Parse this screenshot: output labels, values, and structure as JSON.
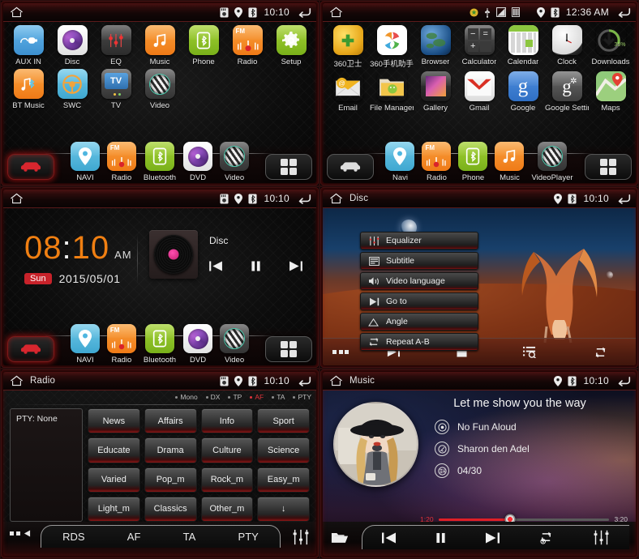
{
  "panels": {
    "home_apps": {
      "statusbar": {
        "time": "10:10",
        "icons": [
          "sdcard-icon",
          "location-pin-icon",
          "bluetooth-icon"
        ],
        "back": "back-arrow-icon"
      },
      "apps_row1": [
        {
          "label": "AUX IN",
          "icon": "aux-plug-icon"
        },
        {
          "label": "Disc",
          "icon": "disc-icon"
        },
        {
          "label": "EQ",
          "icon": "equalizer-icon"
        },
        {
          "label": "Music",
          "icon": "music-note-icon"
        },
        {
          "label": "Phone",
          "icon": "bluetooth-phone-icon"
        },
        {
          "label": "Radio",
          "icon": "fm-radio-icon"
        },
        {
          "label": "Setup",
          "icon": "gear-icon"
        }
      ],
      "apps_row2": [
        {
          "label": "BT Music",
          "icon": "bt-music-icon"
        },
        {
          "label": "SWC",
          "icon": "steering-wheel-icon"
        },
        {
          "label": "TV",
          "icon": "tv-icon"
        },
        {
          "label": "Video",
          "icon": "video-icon"
        }
      ],
      "dock": [
        {
          "label": "NAVI",
          "icon": "location-pin-icon"
        },
        {
          "label": "Radio",
          "icon": "fm-radio-icon"
        },
        {
          "label": "Bluetooth",
          "icon": "bluetooth-icon"
        },
        {
          "label": "DVD",
          "icon": "disc-icon"
        },
        {
          "label": "Video",
          "icon": "video-icon"
        }
      ]
    },
    "android_apps": {
      "statusbar": {
        "time": "12:36 AM",
        "icons": [
          "shield-icon",
          "usb-icon",
          "screenshot-icon",
          "sim-icon",
          "location-pin-icon",
          "bluetooth-icon"
        ],
        "back": "back-arrow-icon"
      },
      "apps_row1": [
        {
          "label": "360卫士",
          "icon": "360-guard-icon"
        },
        {
          "label": "360手机助手",
          "icon": "360-assistant-icon"
        },
        {
          "label": "Browser",
          "icon": "globe-icon"
        },
        {
          "label": "Calculator",
          "icon": "calculator-icon"
        },
        {
          "label": "Calendar",
          "icon": "calendar-icon"
        },
        {
          "label": "Clock",
          "icon": "clock-icon"
        },
        {
          "label": "Downloads",
          "icon": "download-icon",
          "badge": "36%"
        }
      ],
      "apps_row2": [
        {
          "label": "Email",
          "icon": "email-icon"
        },
        {
          "label": "File Manager",
          "icon": "folder-icon"
        },
        {
          "label": "Gallery",
          "icon": "gallery-icon"
        },
        {
          "label": "Gmail",
          "icon": "gmail-icon"
        },
        {
          "label": "Google",
          "icon": "google-g-icon"
        },
        {
          "label": "Google Settings",
          "icon": "google-settings-icon"
        },
        {
          "label": "Maps",
          "icon": "maps-icon"
        }
      ],
      "dock": [
        {
          "label": "Navi",
          "icon": "location-pin-icon"
        },
        {
          "label": "Radio",
          "icon": "fm-radio-icon"
        },
        {
          "label": "Phone",
          "icon": "bluetooth-phone-icon"
        },
        {
          "label": "Music",
          "icon": "music-note-icon"
        },
        {
          "label": "VideoPlayer",
          "icon": "video-icon"
        }
      ]
    },
    "clock_home": {
      "statusbar": {
        "time": "10:10",
        "icons": [
          "sdcard-icon",
          "location-pin-icon",
          "bluetooth-icon"
        ],
        "back": "back-arrow-icon"
      },
      "clock": {
        "hours": "08",
        "colon": ":",
        "minutes": "10",
        "ampm": "AM",
        "weekday": "Sun",
        "date": "2015/05/01"
      },
      "now_playing": {
        "source": "Disc",
        "prev": "prev-track-icon",
        "pause": "pause-icon",
        "next": "next-track-icon"
      },
      "dock": [
        {
          "label": "NAVI",
          "icon": "location-pin-icon"
        },
        {
          "label": "Radio",
          "icon": "fm-radio-icon"
        },
        {
          "label": "Bluetooth",
          "icon": "bluetooth-icon"
        },
        {
          "label": "DVD",
          "icon": "disc-icon"
        },
        {
          "label": "Video",
          "icon": "video-icon"
        }
      ]
    },
    "disc": {
      "statusbar": {
        "title": "Disc",
        "time": "10:10",
        "icons": [
          "location-pin-icon",
          "bluetooth-icon"
        ],
        "back": "back-arrow-icon"
      },
      "menu": [
        {
          "label": "Equalizer",
          "icon": "equalizer-icon"
        },
        {
          "label": "Subtitle",
          "icon": "subtitle-icon"
        },
        {
          "label": "Video language",
          "icon": "audio-language-icon"
        },
        {
          "label": "Go to",
          "icon": "goto-icon"
        },
        {
          "label": "Angle",
          "icon": "angle-icon"
        },
        {
          "label": "Repeat A-B",
          "icon": "repeat-ab-icon"
        }
      ],
      "controls": [
        "more-dots-icon",
        "next-track-icon",
        "stop-icon",
        "playlist-search-icon",
        "repeat-icon"
      ]
    },
    "radio": {
      "statusbar": {
        "title": "Radio",
        "time": "10:10",
        "icons": [
          "sdcard-icon",
          "location-pin-icon",
          "bluetooth-icon"
        ],
        "back": "back-arrow-icon"
      },
      "flags": [
        {
          "label": "Mono",
          "active": false
        },
        {
          "label": "DX",
          "active": false
        },
        {
          "label": "TP",
          "active": false
        },
        {
          "label": "AF",
          "active": true
        },
        {
          "label": "TA",
          "active": false
        },
        {
          "label": "PTY",
          "active": false
        }
      ],
      "pty_label": "PTY:  None",
      "pty_buttons": [
        "News",
        "Affairs",
        "Info",
        "Sport",
        "Educate",
        "Drama",
        "Culture",
        "Science",
        "Varied",
        "Pop_m",
        "Rock_m",
        "Easy_m",
        "Light_m",
        "Classics",
        "Other_m",
        "↓"
      ],
      "tabs": [
        "RDS",
        "AF",
        "TA",
        "PTY"
      ],
      "bottom_right_icon": "equalizer-icon",
      "bottom_left_icon": "back-list-icon"
    },
    "music": {
      "statusbar": {
        "title": "Music",
        "time": "10:10",
        "icons": [
          "location-pin-icon",
          "bluetooth-icon"
        ],
        "back": "back-arrow-icon"
      },
      "track_title": "Let me show you the way",
      "album": "No Fun Aloud",
      "artist": "Sharon den Adel",
      "track_index": "04/30",
      "album_icon": "album-disc-icon",
      "artist_icon": "artist-icon",
      "index_icon": "playlist-icon",
      "progress": {
        "current": "1:20",
        "total": "3:20",
        "percent": 42
      },
      "controls": [
        "folder-icon",
        "prev-track-icon",
        "pause-icon",
        "next-track-icon",
        "repeat-one-icon",
        "equalizer-icon"
      ]
    }
  },
  "colors": {
    "accent_red": "#c8222a",
    "accent_orange": "#f07f12",
    "bezel_red": "#7d1414"
  }
}
